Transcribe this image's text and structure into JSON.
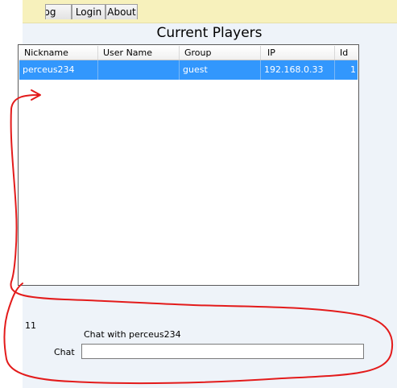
{
  "menu": {
    "tabs": [
      {
        "label": "Log"
      },
      {
        "label": "Login"
      },
      {
        "label": "About"
      }
    ]
  },
  "main": {
    "title": "Current Players",
    "columns": [
      "Nickname",
      "User Name",
      "Group",
      "IP",
      "Id"
    ],
    "rows": [
      {
        "nickname": "perceus234",
        "username": "",
        "group": "guest",
        "ip": "192.168.0.33",
        "id": "1"
      }
    ],
    "count": "11"
  },
  "chat": {
    "with_label": "Chat with perceus234",
    "label": "Chat",
    "value": ""
  },
  "annotation": {
    "color": "#e31b1b"
  }
}
